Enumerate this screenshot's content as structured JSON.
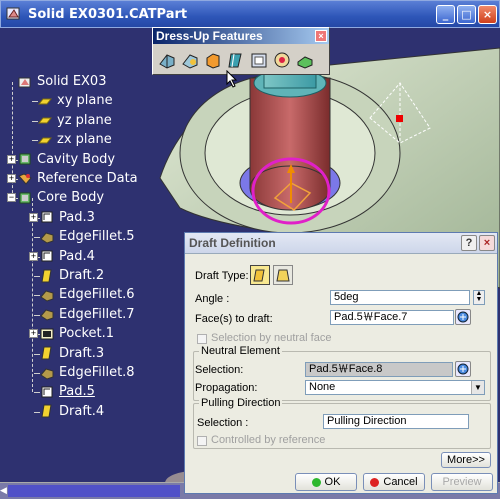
{
  "window": {
    "title": "Solid EX0301.CATPart",
    "min": "_",
    "max": "□",
    "close": "×"
  },
  "toolbar": {
    "title": "Dress-Up Features",
    "close": "×",
    "icons": [
      "fillet-icon",
      "variable-fillet-icon",
      "chamfer-icon",
      "draft-icon",
      "shell-icon",
      "thickness-icon",
      "thread-icon"
    ]
  },
  "tree": {
    "nodes": [
      {
        "label": "Solid EX03",
        "icon": "part-icon"
      },
      {
        "label": "xy plane",
        "icon": "plane-icon"
      },
      {
        "label": "yz plane",
        "icon": "plane-icon"
      },
      {
        "label": "zx plane",
        "icon": "plane-icon"
      },
      {
        "label": "Cavity Body",
        "icon": "body-icon"
      },
      {
        "label": "Reference Data",
        "icon": "geoset-icon"
      },
      {
        "label": "Core Body",
        "icon": "body-icon"
      },
      {
        "label": "Pad.3",
        "icon": "pad-icon"
      },
      {
        "label": "EdgeFillet.5",
        "icon": "fillet-icon"
      },
      {
        "label": "Pad.4",
        "icon": "pad-icon"
      },
      {
        "label": "Draft.2",
        "icon": "draft-icon"
      },
      {
        "label": "EdgeFillet.6",
        "icon": "fillet-icon"
      },
      {
        "label": "EdgeFillet.7",
        "icon": "fillet-icon"
      },
      {
        "label": "Pocket.1",
        "icon": "pocket-icon"
      },
      {
        "label": "Draft.3",
        "icon": "draft-icon"
      },
      {
        "label": "EdgeFillet.8",
        "icon": "fillet-icon"
      },
      {
        "label": "Pad.5",
        "icon": "pad-icon"
      },
      {
        "label": "Draft.4",
        "icon": "draft-icon"
      }
    ]
  },
  "dialog": {
    "title": "Draft Definition",
    "help": "?",
    "close": "×",
    "draft_type_label": "Draft Type:",
    "angle_label": "Angle :",
    "angle_value": "5deg",
    "faces_label": "Face(s) to draft:",
    "faces_value": "Pad.5￦Face.7",
    "neutral_face_label": "Selection by neutral face",
    "neutral_group": "Neutral Element",
    "selection_label": "Selection:",
    "selection_value": "Pad.5￦Face.8",
    "propagation_label": "Propagation:",
    "propagation_value": "None",
    "pulling_group": "Pulling Direction",
    "pulling_selection_label": "Selection :",
    "pulling_selection_value": "Pulling Direction",
    "controlled_label": "Controlled by reference",
    "more_label": "More>>",
    "ok_label": "OK",
    "cancel_label": "Cancel",
    "preview_label": "Preview"
  }
}
